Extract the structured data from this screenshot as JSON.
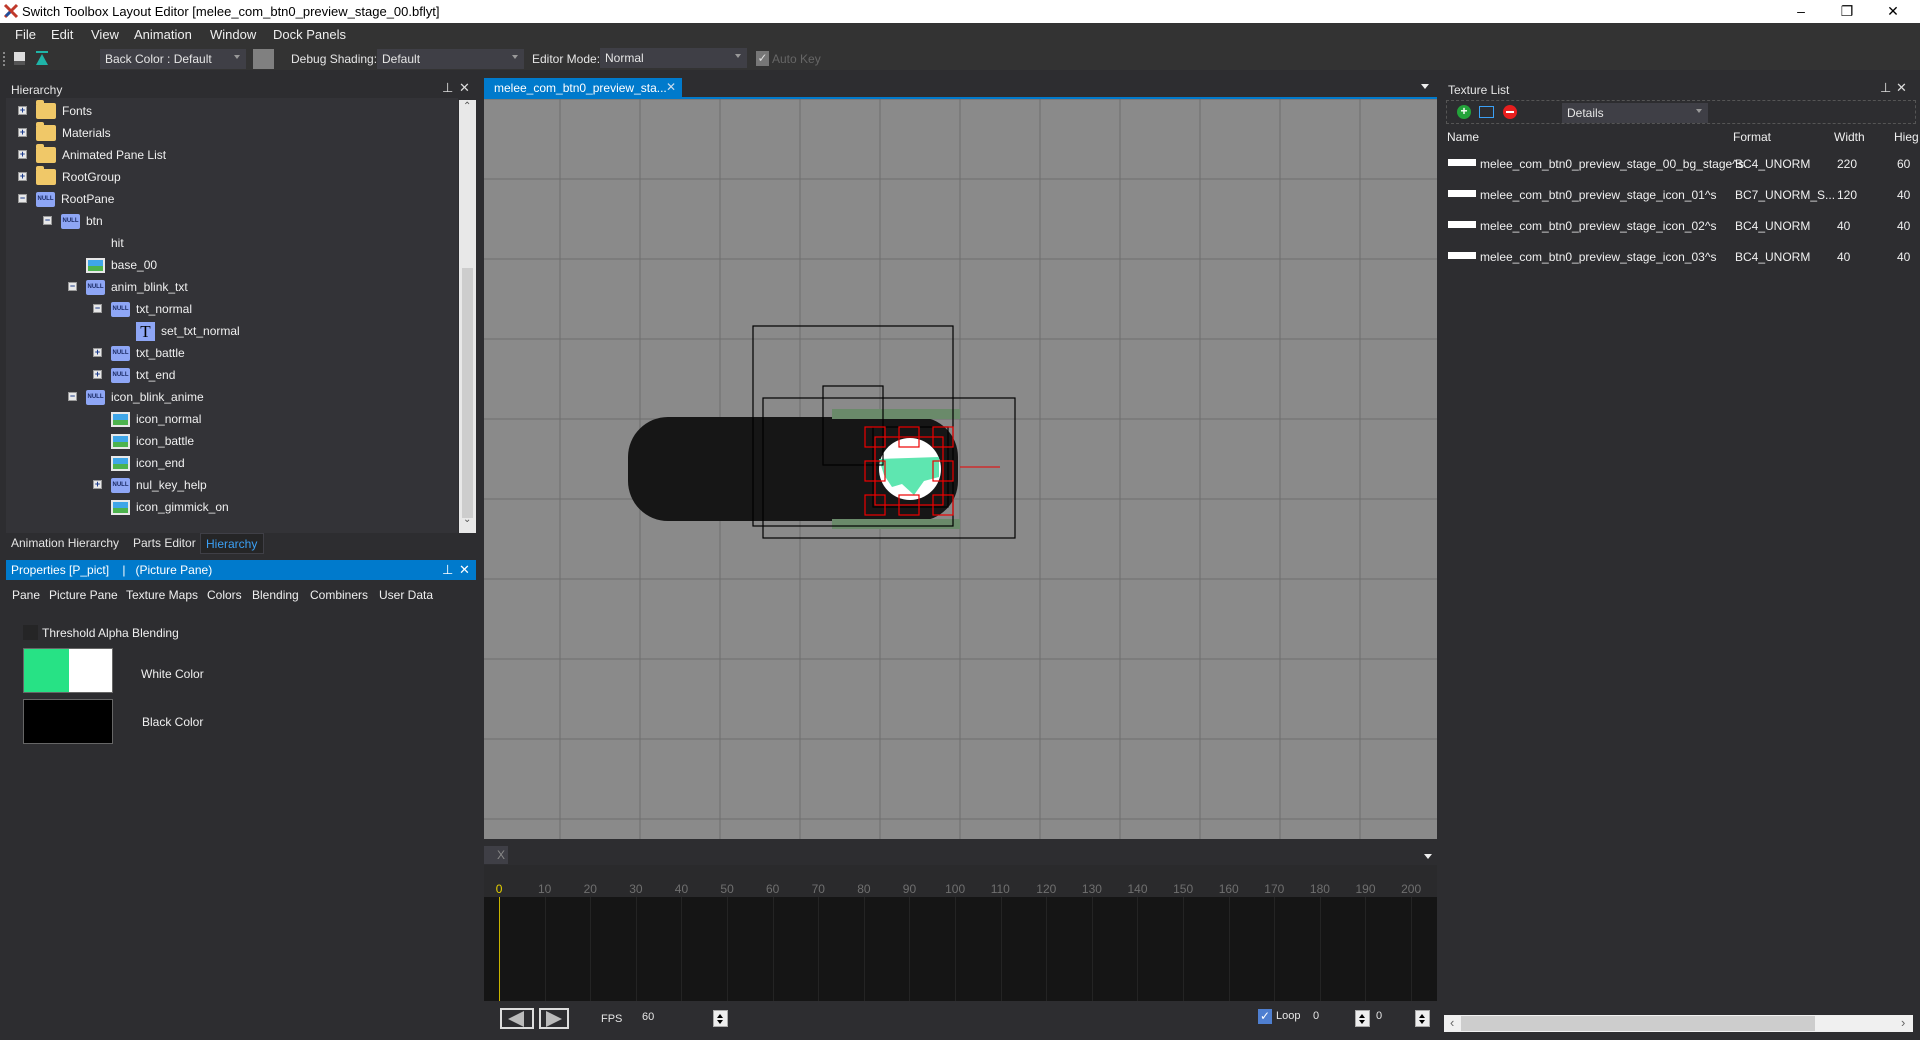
{
  "window": {
    "title": "Switch Toolbox Layout Editor [melee_com_btn0_preview_stage_00.bflyt]",
    "minimize": "–",
    "maximize": "❐",
    "close": "✕"
  },
  "menu": [
    "File",
    "Edit",
    "View",
    "Animation",
    "Window",
    "Dock Panels"
  ],
  "toolbar": {
    "back_color": "Back Color : Default",
    "back_color_swatch": "#808080",
    "debug_shading_label": "Debug Shading:",
    "debug_shading_value": "Default",
    "editor_mode_label": "Editor Mode:",
    "editor_mode_value": "Normal",
    "auto_key_label": "Auto Key",
    "auto_key_checked": true
  },
  "hierarchy": {
    "title": "Hierarchy",
    "items": [
      {
        "label": "Fonts",
        "icon": "folder",
        "level": 0,
        "expander": "+"
      },
      {
        "label": "Materials",
        "icon": "folder",
        "level": 0,
        "expander": "+"
      },
      {
        "label": "Animated Pane List",
        "icon": "folder",
        "level": 0,
        "expander": "+"
      },
      {
        "label": "RootGroup",
        "icon": "folder",
        "level": 0,
        "expander": "+"
      },
      {
        "label": "RootPane",
        "icon": "null",
        "level": 0,
        "expander": "-"
      },
      {
        "label": "btn",
        "icon": "null",
        "level": 1,
        "expander": "-"
      },
      {
        "label": "hit",
        "icon": "none",
        "level": 2,
        "expander": ""
      },
      {
        "label": "base_00",
        "icon": "picture",
        "level": 2,
        "expander": ""
      },
      {
        "label": "anim_blink_txt",
        "icon": "null",
        "level": 2,
        "expander": "-"
      },
      {
        "label": "txt_normal",
        "icon": "null",
        "level": 3,
        "expander": "-"
      },
      {
        "label": "set_txt_normal",
        "icon": "text",
        "level": 4,
        "expander": ""
      },
      {
        "label": "txt_battle",
        "icon": "null",
        "level": 3,
        "expander": "+"
      },
      {
        "label": "txt_end",
        "icon": "null",
        "level": 3,
        "expander": "+"
      },
      {
        "label": "icon_blink_anime",
        "icon": "null",
        "level": 2,
        "expander": "-"
      },
      {
        "label": "icon_normal",
        "icon": "picture",
        "level": 3,
        "expander": ""
      },
      {
        "label": "icon_battle",
        "icon": "picture",
        "level": 3,
        "expander": ""
      },
      {
        "label": "icon_end",
        "icon": "picture",
        "level": 3,
        "expander": ""
      },
      {
        "label": "nul_key_help",
        "icon": "null",
        "level": 3,
        "expander": "+"
      },
      {
        "label": "icon_gimmick_on",
        "icon": "picture",
        "level": 3,
        "expander": ""
      }
    ],
    "null_badge": "NULL",
    "text_badge": "T",
    "bottom_tabs": [
      "Animation Hierarchy",
      "Parts Editor",
      "Hierarchy"
    ],
    "active_bottom_tab": "Hierarchy"
  },
  "properties": {
    "title": "Properties [P_pict]    |   (Picture Pane)",
    "tabs": [
      "Pane",
      "Picture Pane",
      "Texture Maps",
      "Colors",
      "Blending",
      "Combiners",
      "User Data"
    ],
    "threshold_alpha_label": "Threshold Alpha Blending",
    "threshold_alpha_checked": false,
    "white_color_label": "White Color",
    "white_color_swatch": [
      "#27e285",
      "#ffffff"
    ],
    "black_color_label": "Black Color",
    "black_color_swatch": "#000000"
  },
  "document_tab": {
    "label": "melee_com_btn0_preview_sta...",
    "close": "✕",
    "accent": "#007acc"
  },
  "canvas": {
    "background": "#8a8a8a",
    "grid_color": "#6e6e6e"
  },
  "texture_list": {
    "title": "Texture List",
    "view_mode": "Details",
    "columns": [
      "Name",
      "Format",
      "Width",
      "Hieg"
    ],
    "rows": [
      {
        "name": "melee_com_btn0_preview_stage_00_bg_stage^s",
        "format": "BC4_UNORM",
        "width": "220",
        "height": "60"
      },
      {
        "name": "melee_com_btn0_preview_stage_icon_01^s",
        "format": "BC7_UNORM_S...",
        "width": "120",
        "height": "40"
      },
      {
        "name": "melee_com_btn0_preview_stage_icon_02^s",
        "format": "BC4_UNORM",
        "width": "40",
        "height": "40"
      },
      {
        "name": "melee_com_btn0_preview_stage_icon_03^s",
        "format": "BC4_UNORM",
        "width": "40",
        "height": "40"
      }
    ]
  },
  "timeline": {
    "tab_close": "X",
    "ticks": [
      "0",
      "10",
      "20",
      "30",
      "40",
      "50",
      "60",
      "70",
      "80",
      "90",
      "100",
      "110",
      "120",
      "130",
      "140",
      "150",
      "160",
      "170",
      "180",
      "190",
      "200"
    ],
    "current_frame": 0,
    "fps_label": "FPS",
    "fps_value": "60",
    "loop_label": "Loop",
    "loop_checked": true,
    "loop_value": "0",
    "frame_value": "0"
  }
}
